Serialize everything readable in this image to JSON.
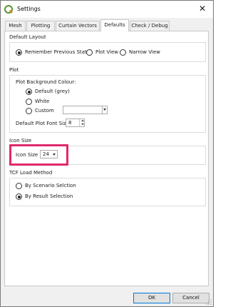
{
  "window": {
    "title": "Settings"
  },
  "tabs": [
    {
      "label": "Mesh",
      "active": false
    },
    {
      "label": "Plotting",
      "active": false
    },
    {
      "label": "Curtain Vectors",
      "active": false
    },
    {
      "label": "Defaults",
      "active": true
    },
    {
      "label": "Check / Debug",
      "active": false
    }
  ],
  "default_layout": {
    "heading": "Default Layout",
    "options": [
      {
        "label": "Remember Previous State",
        "checked": true
      },
      {
        "label": "Plot View",
        "checked": false
      },
      {
        "label": "Narrow View",
        "checked": false
      }
    ]
  },
  "plot": {
    "heading": "Plot",
    "bg_colour_label": "Plot Background Colour:",
    "bg_options": [
      {
        "label": "Default (grey)",
        "checked": true
      },
      {
        "label": "White",
        "checked": false
      },
      {
        "label": "Custom",
        "checked": false
      }
    ],
    "custom_colour_value": "",
    "font_size_label": "Default Plot Font Size",
    "font_size_value": "8"
  },
  "icon_size": {
    "heading": "Icon Size",
    "label": "Icon Size",
    "value": "24"
  },
  "tcf_load_method": {
    "heading": "TCF Load Method",
    "options": [
      {
        "label": "By Scenario Selction",
        "checked": false
      },
      {
        "label": "By Result Selection",
        "checked": true
      }
    ]
  },
  "buttons": {
    "ok": "OK",
    "cancel": "Cancel"
  },
  "colors": {
    "highlight": "#e0286a",
    "default_button_border": "#0078d7"
  }
}
